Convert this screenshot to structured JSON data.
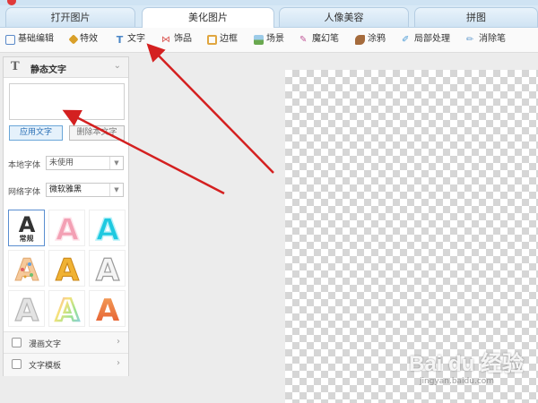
{
  "tabs": [
    {
      "label": "打开图片",
      "active": false
    },
    {
      "label": "美化图片",
      "active": true
    },
    {
      "label": "人像美容",
      "active": false
    },
    {
      "label": "拼图",
      "active": false
    }
  ],
  "toolbar": [
    {
      "label": "基础编辑",
      "icon": "basic-edit-icon",
      "color": "#5b8ac9"
    },
    {
      "label": "特效",
      "icon": "effects-icon",
      "color": "#d9a02a"
    },
    {
      "label": "文字",
      "icon": "text-icon",
      "color": "#4a86c7"
    },
    {
      "label": "饰品",
      "icon": "accessory-icon",
      "color": "#d9534f"
    },
    {
      "label": "边框",
      "icon": "frame-icon",
      "color": "#e0a640"
    },
    {
      "label": "场景",
      "icon": "scene-icon",
      "color": "#6aa84f"
    },
    {
      "label": "魔幻笔",
      "icon": "magic-pen-icon",
      "color": "#c15a9a"
    },
    {
      "label": "涂鸦",
      "icon": "doodle-icon",
      "color": "#a56b3c"
    },
    {
      "label": "局部处理",
      "icon": "local-process-icon",
      "color": "#4b9bd6"
    },
    {
      "label": "消除笔",
      "icon": "eraser-pen-icon",
      "color": "#6aa0d0"
    }
  ],
  "panel": {
    "title": "静态文字",
    "apply_button": "应用文字",
    "delete_button": "删除本文字",
    "local_font_label": "本地字体",
    "local_font_value": "未使用",
    "web_font_label": "网络字体",
    "web_font_value": "微软雅黑",
    "selected_style_caption": "常规",
    "styles": [
      {
        "name": "regular",
        "letter": "A",
        "fill": "#333333",
        "stroke": "#333333"
      },
      {
        "name": "pink",
        "letter": "A",
        "fill": "#f3a0b4",
        "stroke": "#ffffff"
      },
      {
        "name": "cyan",
        "letter": "A",
        "fill": "#1ec9e0",
        "stroke": "#ffffff"
      },
      {
        "name": "dotted",
        "letter": "A",
        "fill": "#f6c99a",
        "stroke": "#e0a870"
      },
      {
        "name": "gold",
        "letter": "A",
        "fill": "#f0b233",
        "stroke": "#c78417"
      },
      {
        "name": "silver",
        "letter": "A",
        "fill": "#f0f0f0",
        "stroke": "#a9a9a9"
      },
      {
        "name": "grey",
        "letter": "A",
        "fill": "#dcdcdc",
        "stroke": "#b5b5b5"
      },
      {
        "name": "rainbow",
        "letter": "A",
        "fill": "#b7e3a1",
        "stroke": "#9ad1f2"
      },
      {
        "name": "orange",
        "letter": "A",
        "fill": "#f08a3c",
        "stroke": "#e0622a"
      }
    ],
    "footer": [
      {
        "label": "漫画文字"
      },
      {
        "label": "文字模板"
      }
    ]
  },
  "watermark": {
    "main": "Bai du 经验",
    "sub": "jingyan.baidu.com"
  },
  "colors": {
    "accent": "#2a6fb5",
    "arrow": "#d42020"
  }
}
